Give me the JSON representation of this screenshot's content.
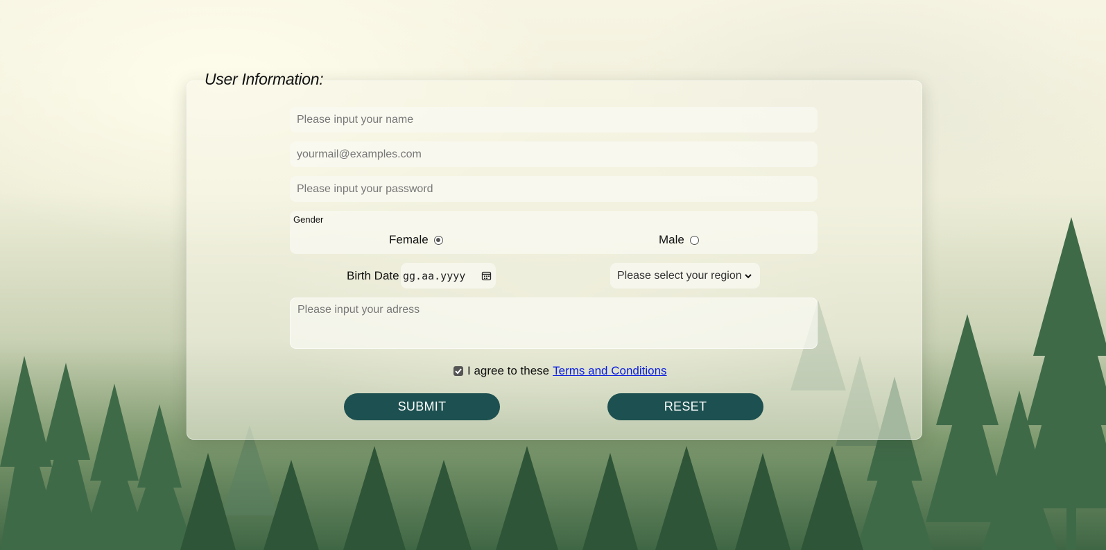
{
  "form": {
    "title": "User Information:",
    "name_placeholder": "Please input your name",
    "email_placeholder": "yourmail@examples.com",
    "password_placeholder": "Please input your password",
    "gender": {
      "legend": "Gender",
      "options": [
        {
          "label": "Female",
          "checked": true
        },
        {
          "label": "Male",
          "checked": false
        }
      ]
    },
    "birth_date": {
      "label": "Birth Date",
      "format_text": "gg.aa.yyyy",
      "icon": "calendar-icon"
    },
    "region": {
      "selected": "Please select your region",
      "icon": "chevron-down-icon"
    },
    "address_placeholder": "Please input your adress",
    "agree": {
      "checked": true,
      "text": "I agree to these",
      "link": "Terms and Conditions"
    },
    "submit_label": "SUBMIT",
    "reset_label": "RESET"
  },
  "colors": {
    "button_bg": "#1d5050",
    "link": "#0b1ee0"
  }
}
